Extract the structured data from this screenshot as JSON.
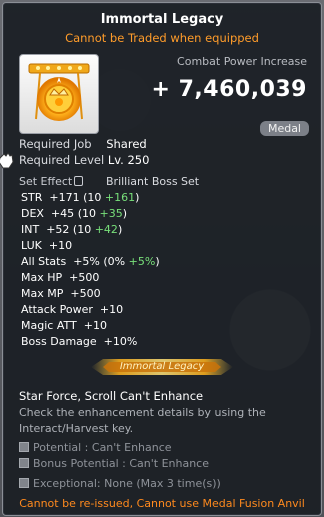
{
  "tooltip": {
    "title": "Immortal Legacy",
    "subtitle": "Cannot be Traded when equipped",
    "combat_power_label": "Combat Power Increase",
    "combat_power_value": "+ 7,460,039",
    "category_badge": "Medal",
    "required_job_label": "Required Job",
    "required_job_value": "Shared",
    "required_level_label": "Required Level",
    "required_level_value": "Lv. 250",
    "set_effect_label": "Set Effect",
    "set_name": "Brilliant Boss Set",
    "stats": [
      {
        "name": "STR",
        "value": "+171",
        "base": "(10 ",
        "extra": "+161",
        "close": ")"
      },
      {
        "name": "DEX",
        "value": "+45",
        "base": "(10 ",
        "extra": "+35",
        "close": ")"
      },
      {
        "name": "INT",
        "value": "+52",
        "base": "(10 ",
        "extra": "+42",
        "close": ")"
      },
      {
        "name": "LUK",
        "value": "+10",
        "base": "",
        "extra": "",
        "close": ""
      },
      {
        "name": "All Stats",
        "value": "+5%",
        "base": "(0% ",
        "extra": "+5%",
        "close": ")"
      },
      {
        "name": "Max HP",
        "value": "+500",
        "base": "",
        "extra": "",
        "close": ""
      },
      {
        "name": "Max MP",
        "value": "+500",
        "base": "",
        "extra": "",
        "close": ""
      },
      {
        "name": "Attack Power",
        "value": "+10",
        "base": "",
        "extra": "",
        "close": ""
      },
      {
        "name": "Magic ATT",
        "value": "+10",
        "base": "",
        "extra": "",
        "close": ""
      },
      {
        "name": "Boss Damage",
        "value": "+10%",
        "base": "",
        "extra": "",
        "close": ""
      }
    ],
    "nameplate_text": "Immortal Legacy",
    "enhance_status": "Star Force, Scroll Can't Enhance",
    "enhance_hint": "Check the enhancement details by using the Interact/Harvest key.",
    "potential": "Potential : Can't Enhance",
    "bonus_potential": "Bonus Potential : Can't Enhance",
    "exceptional": "Exceptional: None (Max 3 time(s))",
    "footer_warning": "Cannot be re-issued, Cannot use Medal Fusion Anvil"
  },
  "colors": {
    "subtitle": "#ff9c2a",
    "bonus_green": "#78e07a",
    "footer": "#ff8a1e",
    "panel_bg": "#1a1e24"
  },
  "icons": {
    "item": "golden-crown-medal-icon",
    "lock": "lock-icon",
    "cursor": "hand-cursor-icon",
    "checkbox": "square-bullet-icon"
  }
}
